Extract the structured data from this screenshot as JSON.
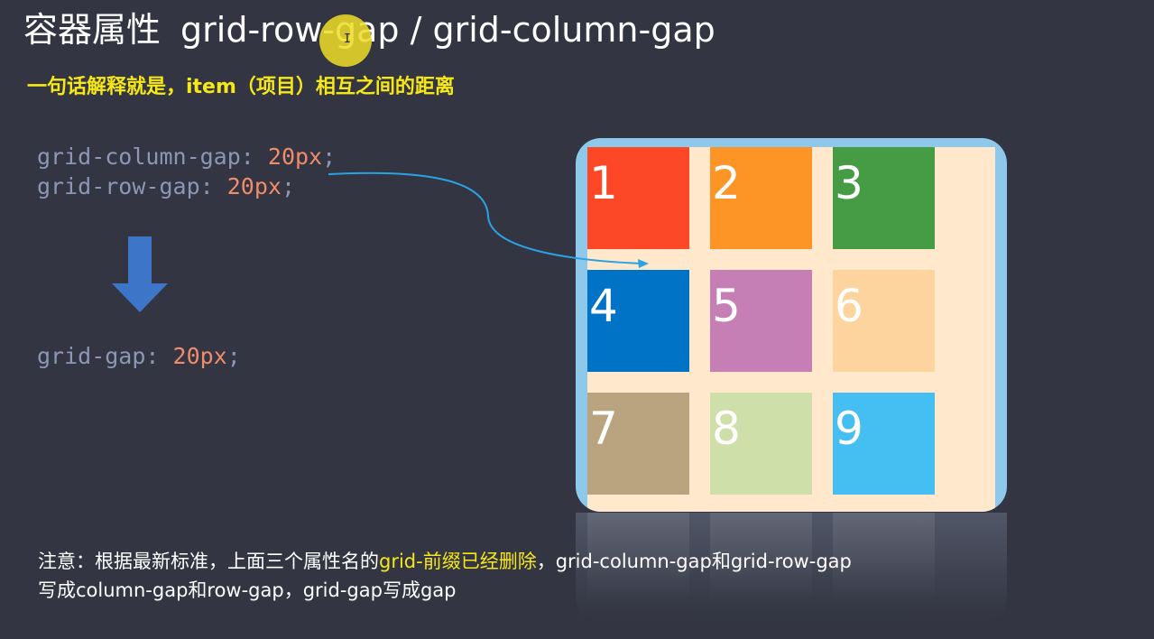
{
  "title": {
    "main": "容器属性",
    "props": "grid-row-gap / grid-column-gap"
  },
  "subtitle": "一句话解释就是，item（项目）相互之间的距离",
  "code_before": [
    {
      "prop": "grid-column-gap",
      "value": "20px"
    },
    {
      "prop": "grid-row-gap",
      "value": "20px"
    }
  ],
  "code_after": {
    "prop": "grid-gap",
    "value": "20px"
  },
  "code_punct": {
    "colon": ": ",
    "semicolon": ";"
  },
  "grid_items": [
    {
      "label": "1",
      "color": "#fc4827"
    },
    {
      "label": "2",
      "color": "#fd9426"
    },
    {
      "label": "3",
      "color": "#469c44"
    },
    {
      "label": "4",
      "color": "#0173c7"
    },
    {
      "label": "5",
      "color": "#c57fb4"
    },
    {
      "label": "6",
      "color": "#fdd49d"
    },
    {
      "label": "7",
      "color": "#b9a47f"
    },
    {
      "label": "8",
      "color": "#cedfa9"
    },
    {
      "label": "9",
      "color": "#45bef1"
    }
  ],
  "colors": {
    "background": "#333542",
    "subtitle": "#f6e716",
    "code_property": "#8d96b4",
    "code_value": "#f08c6a",
    "arrow": "#3d75c9",
    "container_border": "#8ec9ec",
    "container_fill": "#ffe8cc"
  },
  "note": {
    "line1_part1": "注意：根据最新标准，上面三个属性名的",
    "line1_highlight": "grid-前缀已经删除",
    "line1_part2": "，grid-column-gap和grid-row-gap",
    "line2": "写成column-gap和row-gap，grid-gap写成gap"
  },
  "cursor": {
    "glyph": "I"
  }
}
